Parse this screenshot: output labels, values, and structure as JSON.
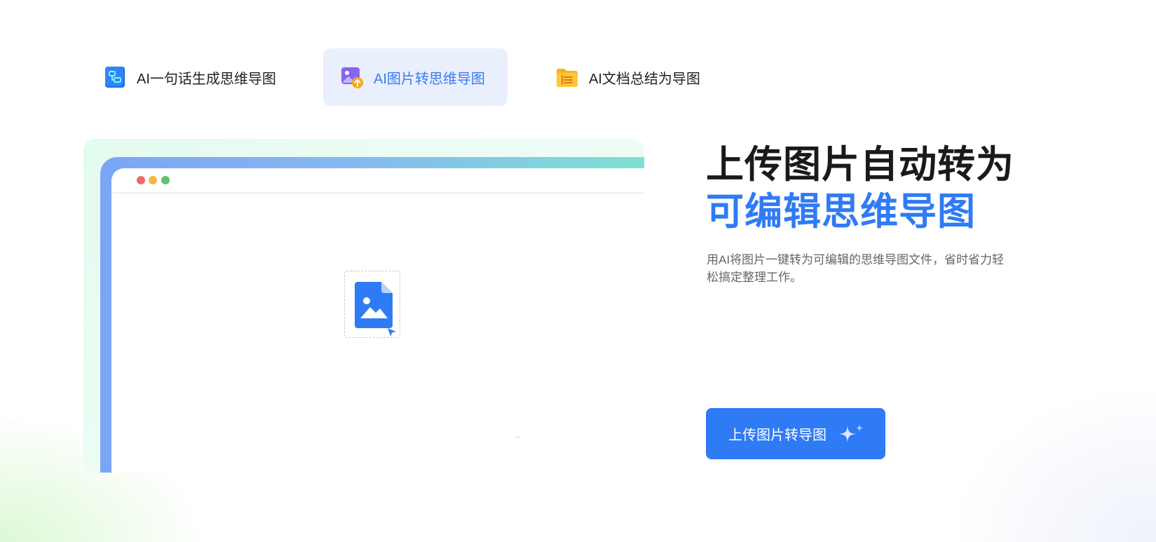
{
  "tabs": [
    {
      "label": "AI一句话生成思维导图",
      "icon": "mindmap-icon",
      "active": false
    },
    {
      "label": "AI图片转思维导图",
      "icon": "image-upload-icon",
      "active": true
    },
    {
      "label": "AI文档总结为导图",
      "icon": "folder-list-icon",
      "active": false
    }
  ],
  "hero": {
    "title_line1": "上传图片自动转为",
    "title_line2": "可编辑思维导图",
    "description": "用AI将图片一键转为可编辑的思维导图文件，省时省力轻松搞定整理工作。",
    "cta_label": "上传图片转导图"
  },
  "colors": {
    "accent": "#2f7bf5",
    "active_tab_bg": "#e9effc",
    "title_dark": "#1a1a1a",
    "window_dot_red": "#ee6b66",
    "window_dot_yellow": "#f5b740",
    "window_dot_green": "#5fc26e"
  },
  "preview": {
    "icons": [
      "image-file-icon",
      "cursor-icon"
    ]
  }
}
